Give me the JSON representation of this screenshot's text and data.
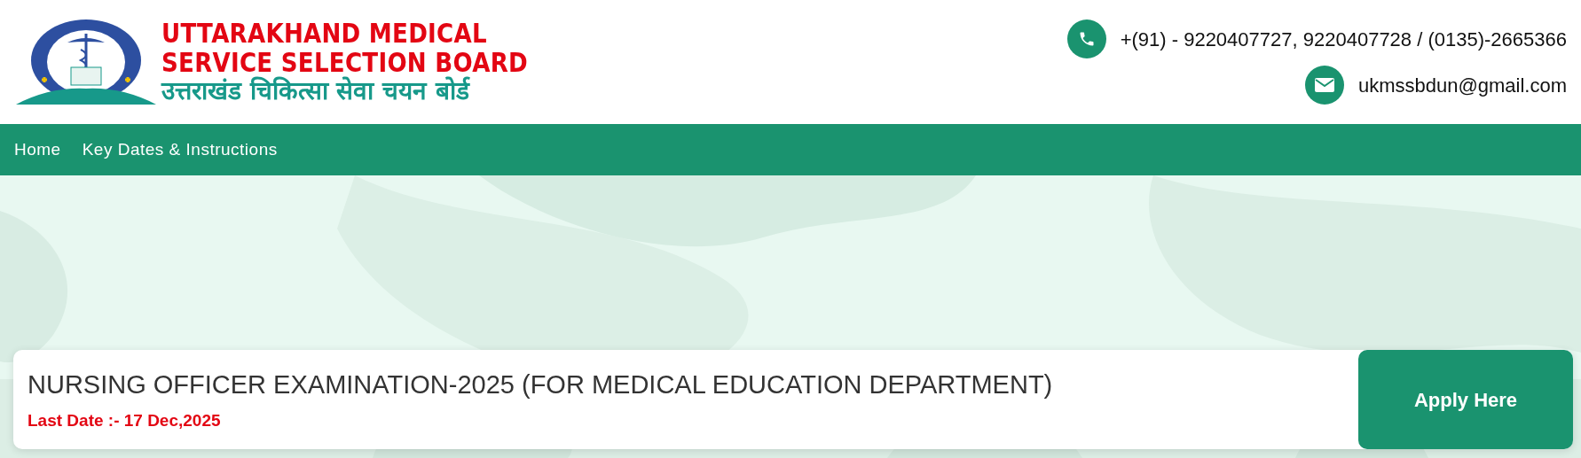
{
  "header": {
    "title_lines": [
      "UTTARAKHAND MEDICAL",
      "SERVICE SELECTION BOARD"
    ],
    "title_hindi": "उत्तराखंड चिकित्सा सेवा चयन बोर्ड",
    "contacts": [
      {
        "kind": "phone",
        "text": "+(91) - 9220407727, 9220407728 / (0135)-2665366"
      },
      {
        "kind": "email",
        "text": "ukmssbdun@gmail.com"
      }
    ]
  },
  "nav": {
    "items": [
      {
        "label": "Home"
      },
      {
        "label": "Key Dates & Instructions"
      }
    ]
  },
  "notice": {
    "title": "NURSING OFFICER EXAMINATION-2025 (FOR MEDICAL EDUCATION DEPARTMENT)",
    "last_date": "Last Date :- 17 Dec,2025",
    "button": "Apply Here"
  }
}
